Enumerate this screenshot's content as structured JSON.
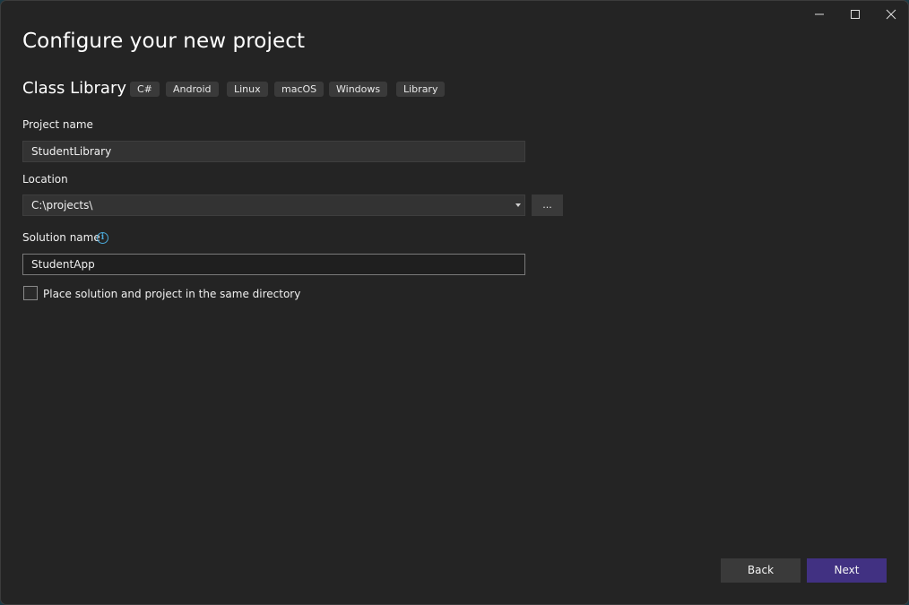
{
  "window": {
    "controls": {
      "minimize_icon": "minimize-icon",
      "maximize_icon": "maximize-icon",
      "close_icon": "close-icon"
    }
  },
  "header": {
    "title": "Configure your new project",
    "template_name": "Class Library",
    "tags": [
      "C#",
      "Android",
      "Linux",
      "macOS",
      "Windows",
      "Library"
    ]
  },
  "form": {
    "project_name": {
      "label": "Project name",
      "value": "StudentLibrary"
    },
    "location": {
      "label": "Location",
      "value": "C:\\projects\\",
      "browse_label": "..."
    },
    "solution_name": {
      "label": "Solution name",
      "value": "StudentApp",
      "info_icon": "info-icon"
    },
    "same_directory": {
      "label": "Place solution and project in the same directory",
      "checked": false
    }
  },
  "footer": {
    "back_label": "Back",
    "next_label": "Next"
  },
  "colors": {
    "background": "#242424",
    "accent": "#413182",
    "info": "#4aa8d8"
  }
}
